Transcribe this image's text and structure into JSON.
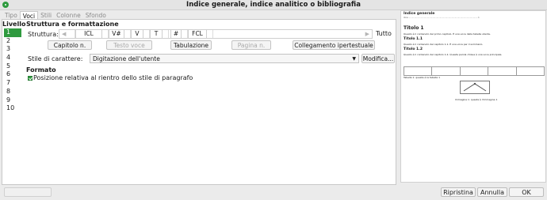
{
  "window": {
    "title": "Indice generale, indice analitico o bibliografia"
  },
  "tabs": [
    "Tipo",
    "Voci",
    "Stili",
    "Colonne",
    "Sfondo"
  ],
  "active_tab": "Voci",
  "level": {
    "header": "Livello",
    "items": [
      "1",
      "2",
      "3",
      "4",
      "5",
      "6",
      "7",
      "8",
      "9",
      "10"
    ],
    "selected": "1"
  },
  "structure": {
    "header": "Struttura e formattazione",
    "label": "Struttura:",
    "tokens": [
      "ICL",
      "V#",
      "V",
      "T",
      "#",
      "FCL"
    ],
    "all_button": "Tutto",
    "buttons": {
      "chapter_no": "Capitolo n.",
      "entry_text": "Testo voce",
      "tab": "Tabulazione",
      "page_no": "Pagina n.",
      "hyperlink": "Collegamento ipertestuale"
    },
    "char_style_label": "Stile di carattere:",
    "char_style_value": "Digitazione dell'utente",
    "modify_button": "Modifica..."
  },
  "format": {
    "header": "Formato",
    "relative_indent_label": "Posizione relativa al rientro dello stile di paragrafo",
    "relative_indent_checked": true
  },
  "preview": {
    "toc_title": "Indice generale",
    "toc_line": "Voce ............................................................................................................. 1",
    "h1": "Titolo 1",
    "h1_text": "Questo è il contenuto del primo capitolo. È una voce della tabella utente.",
    "h11": "Titolo 1.1",
    "h11_text": "Questo è il contenuto del capitolo 1.1. È una voce per il sommario.",
    "h12": "Titolo 1.2",
    "h12_text": "Questo è il contenuto del capitolo 1.2. Questa parola chiave è una voce principale.",
    "table_caption": "Tabella 1: questa è la tabella 1",
    "image_caption": "Immagine 1: questa è l'immagine 1"
  },
  "footer": {
    "reset": "Ripristina",
    "cancel": "Annulla",
    "ok": "OK"
  },
  "colors": {
    "accent": "#2f9a3f"
  },
  "icons": {
    "app": "writer-app-icon",
    "checkbox": "checkbox-checked-icon",
    "dropdown": "chevron-down-icon"
  }
}
